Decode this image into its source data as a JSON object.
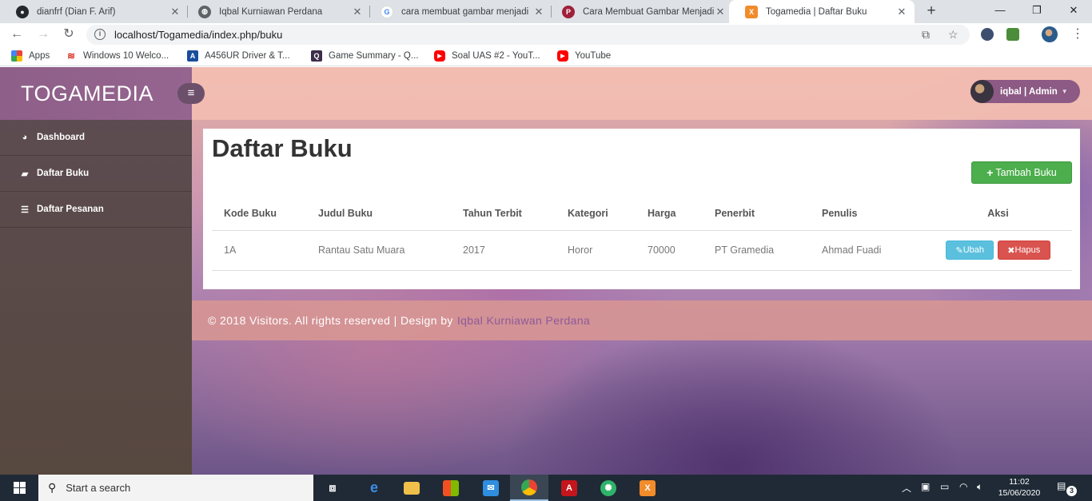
{
  "browser": {
    "tabs": [
      {
        "title": "dianfrf (Dian F. Arif)",
        "icon": "github-icon"
      },
      {
        "title": "Iqbal Kurniawan Perdana",
        "icon": "globe-icon"
      },
      {
        "title": "cara membuat gambar menjadi",
        "icon": "google-icon"
      },
      {
        "title": "Cara Membuat Gambar Menjadi",
        "icon": "pinterest-icon"
      },
      {
        "title": "Togamedia | Daftar Buku",
        "icon": "xampp-icon",
        "active": true
      }
    ],
    "url": "localhost/Togamedia/index.php/buku",
    "bookmarks": [
      {
        "label": "Apps",
        "icon": "apps-grid-icon"
      },
      {
        "label": "Windows 10 Welco...",
        "icon": "wifi-icon"
      },
      {
        "label": "A456UR Driver & T...",
        "icon": "asus-icon"
      },
      {
        "label": "Game Summary - Q...",
        "icon": "q-icon"
      },
      {
        "label": "Soal UAS #2 - YouT...",
        "icon": "youtube-icon"
      },
      {
        "label": "YouTube",
        "icon": "youtube-icon"
      }
    ]
  },
  "app": {
    "brand": "TOGAMEDIA",
    "user": "iqbal | Admin",
    "sidebar": [
      {
        "label": "Dashboard",
        "icon": "dashboard-icon"
      },
      {
        "label": "Daftar Buku",
        "icon": "book-icon"
      },
      {
        "label": "Daftar Pesanan",
        "icon": "list-icon"
      }
    ],
    "page_title": "Daftar Buku",
    "add_button": "Tambah Buku",
    "table": {
      "headers": [
        "Kode Buku",
        "Judul Buku",
        "Tahun Terbit",
        "Kategori",
        "Harga",
        "Penerbit",
        "Penulis",
        "Aksi"
      ],
      "rows": [
        {
          "kode": "1A",
          "judul": "Rantau Satu Muara",
          "tahun": "2017",
          "kategori": "Horor",
          "harga": "70000",
          "penerbit": "PT Gramedia",
          "penulis": "Ahmad Fuadi",
          "ubah": "Ubah",
          "hapus": "Hapus"
        }
      ]
    },
    "footer": {
      "text": "© 2018 Visitors. All rights reserved | Design by",
      "author": "Iqbal Kurniawan Perdana"
    },
    "colors": {
      "brand": "#956590",
      "add_button": "#4cae4c",
      "edit_button": "#5bc0de",
      "delete_button": "#d9534f"
    }
  },
  "taskbar": {
    "search_placeholder": "Start a search",
    "time": "11:02",
    "date": "15/06/2020",
    "notifications": "3"
  }
}
